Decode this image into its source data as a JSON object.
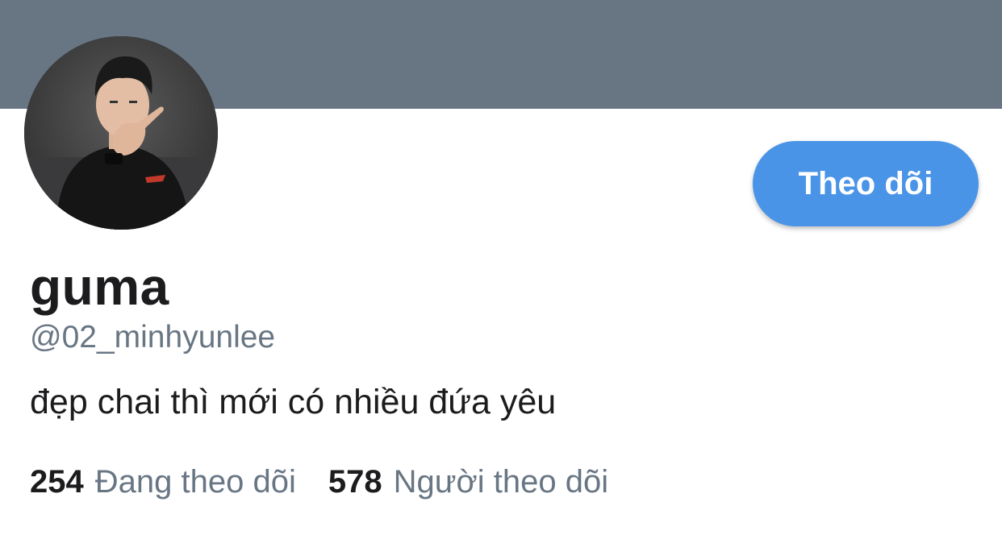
{
  "colors": {
    "banner": "#687684",
    "button": "#4a94e8",
    "button_text": "#ffffff",
    "primary_text": "#1c1c1e",
    "secondary_text": "#687684"
  },
  "profile": {
    "avatar_icon": "user-photo",
    "display_name": "guma",
    "handle": "@02_minhyunlee",
    "bio": "đẹp chai thì mới có nhiều đứa yêu"
  },
  "actions": {
    "follow_label": "Theo dõi"
  },
  "stats": {
    "following_count": "254",
    "following_label": "Đang theo dõi",
    "followers_count": "578",
    "followers_label": "Người theo dõi"
  }
}
